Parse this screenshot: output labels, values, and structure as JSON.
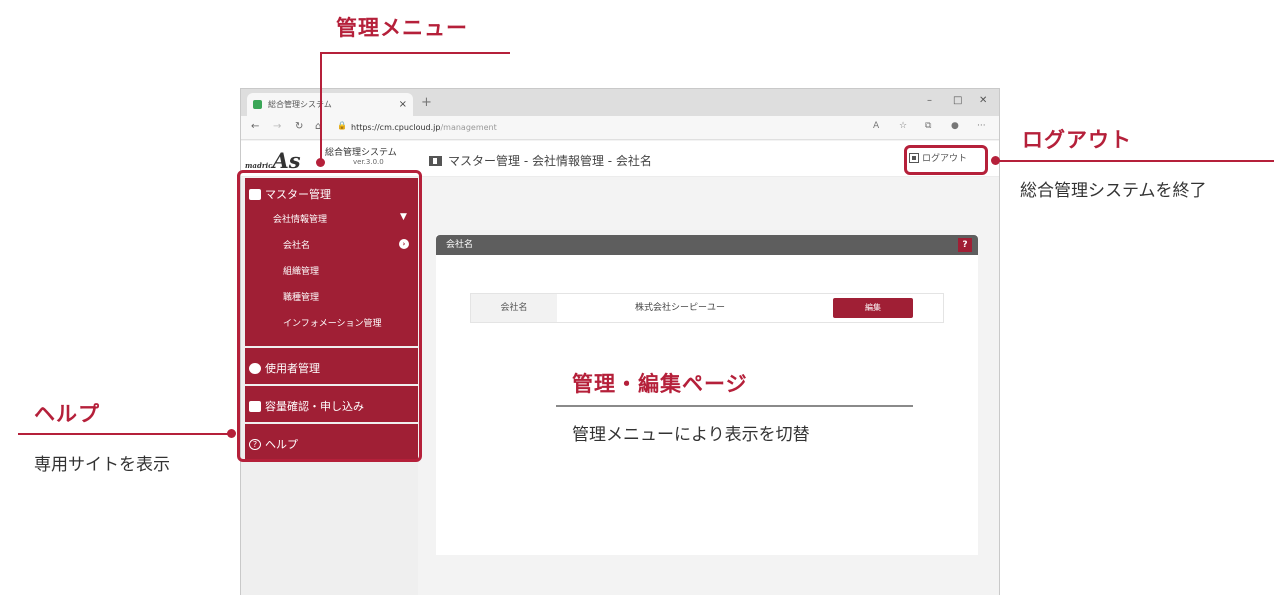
{
  "callouts": {
    "menu": {
      "title": "管理メニュー"
    },
    "logout": {
      "title": "ログアウト",
      "desc": "総合管理システムを終了"
    },
    "help": {
      "title": "ヘルプ",
      "desc": "専用サイトを表示"
    },
    "edit": {
      "title": "管理・編集ページ",
      "desc": "管理メニューにより表示を切替"
    }
  },
  "browser": {
    "tab_title": "総合管理システム",
    "tab_close": "×",
    "new_tab": "+",
    "win_min": "–",
    "win_max": "□",
    "win_close": "✕",
    "url_host": "https://cm.cpucloud.jp",
    "url_path": "/management"
  },
  "app": {
    "logo_small": "madric",
    "logo_big": "As",
    "system_name": "総合管理システム",
    "version": "ver.3.0.0",
    "breadcrumb": "マスター管理 - 会社情報管理 - 会社名",
    "logout_label": "ログアウト"
  },
  "sidebar": {
    "master": {
      "label": "マスター管理",
      "group": "会社情報管理",
      "items": [
        "会社名",
        "組織管理",
        "職種管理",
        "インフォメーション管理"
      ]
    },
    "users": "使用者管理",
    "capacity": "容量確認・申し込み",
    "help": "ヘルプ"
  },
  "panel": {
    "title": "会社名",
    "help_label": "?",
    "row_label": "会社名",
    "row_value": "株式会社シーピーユー",
    "edit_label": "編集"
  },
  "colors": {
    "accent": "#a01f35",
    "callout": "#b5203a"
  }
}
